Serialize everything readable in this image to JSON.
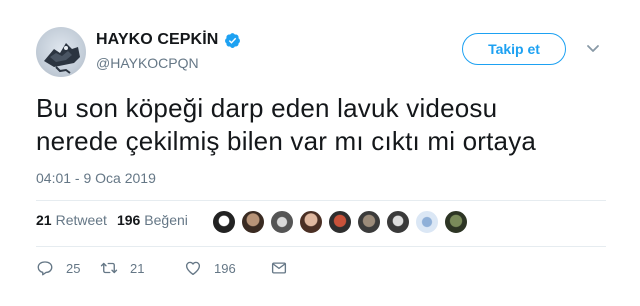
{
  "user": {
    "display_name": "HAYKO CEPKİN",
    "handle": "@HAYKOCPQN",
    "verified": true
  },
  "follow_button": {
    "label": "Takip et"
  },
  "tweet": {
    "line1": "Bu son köpeği darp eden lavuk videosu",
    "line2": "nerede çekilmiş bilen var mı cıktı mi ortaya",
    "timestamp": "04:01 - 9 Oca 2019"
  },
  "stats": {
    "retweets": "21",
    "retweets_label": "Retweet",
    "likes": "196",
    "likes_label": "Beğeni"
  },
  "liker_avatars": [
    "avatar-1",
    "avatar-2",
    "avatar-3",
    "avatar-4",
    "avatar-5",
    "avatar-6",
    "avatar-7",
    "avatar-8",
    "avatar-9"
  ],
  "actions": {
    "reply_count": "25",
    "retweet_count": "21",
    "like_count": "196"
  },
  "colors": {
    "accent": "#1da1f2",
    "text": "#14171a",
    "muted": "#657786",
    "divider": "#e6ecf0"
  },
  "icons": [
    "verified-badge-icon",
    "chevron-down-icon",
    "reply-icon",
    "retweet-icon",
    "like-icon",
    "direct-message-icon"
  ]
}
